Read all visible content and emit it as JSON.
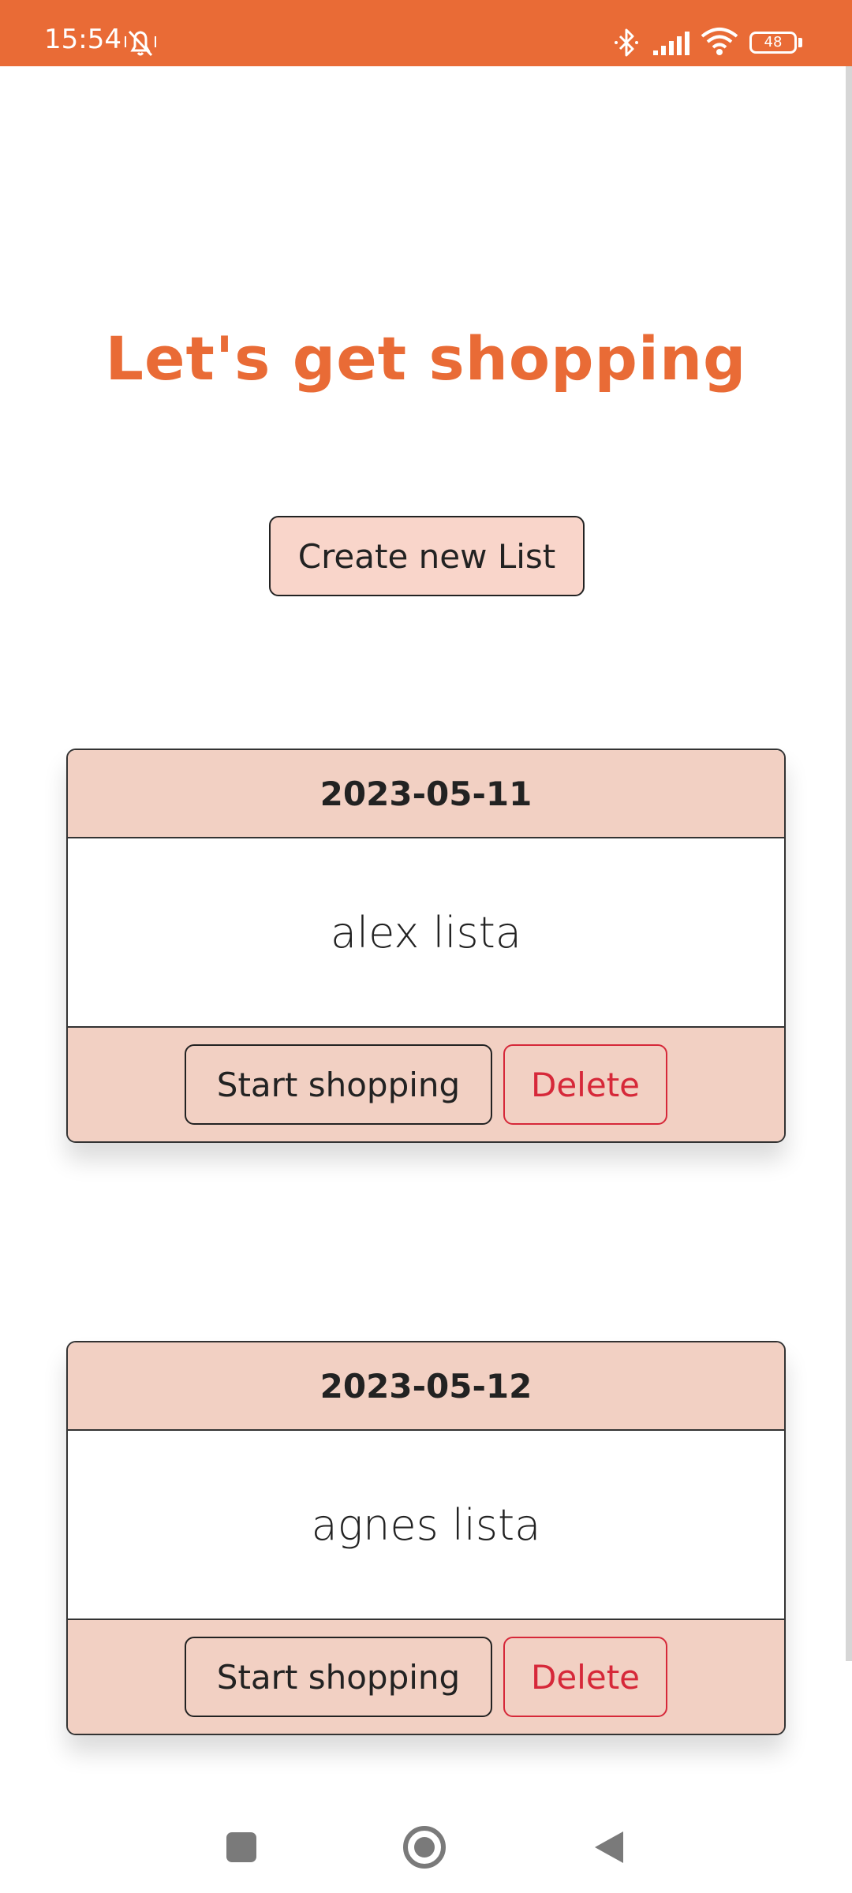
{
  "status_bar": {
    "time": "15:54",
    "battery": "48",
    "background_color": "#E96B36",
    "icons": [
      "mute-icon",
      "bluetooth-icon",
      "signal-icon",
      "wifi-icon",
      "battery-icon"
    ]
  },
  "main": {
    "title": "Let's get shopping",
    "create_button_label": "Create new List",
    "accent_color": "#E96B36",
    "lists": [
      {
        "date": "2023-05-11",
        "name": "alex lista",
        "start_label": "Start shopping",
        "delete_label": "Delete"
      },
      {
        "date": "2023-05-12",
        "name": "agnes lista",
        "start_label": "Start shopping",
        "delete_label": "Delete"
      }
    ]
  },
  "nav_bar": {
    "icons": [
      "recents-icon",
      "home-icon",
      "back-icon"
    ]
  }
}
